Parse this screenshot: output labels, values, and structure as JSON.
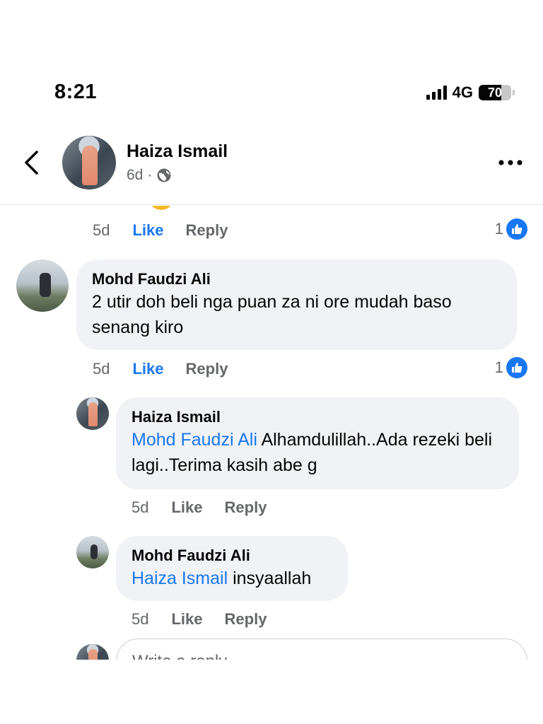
{
  "status_bar": {
    "time": "8:21",
    "network": "4G",
    "battery_level": "70",
    "battery_fraction": 0.7
  },
  "header": {
    "back_icon": "chevron-left-icon",
    "author_name": "Haiza Ismail",
    "post_age": "6d",
    "separator": "·",
    "audience_icon": "globe-icon",
    "more_icon": "more-horizontal-icon"
  },
  "comments": {
    "top_actions": {
      "time": "5d",
      "like": "Like",
      "reply": "Reply",
      "reaction_count": "1"
    },
    "items": [
      {
        "author": "Mohd Faudzi Ali",
        "text": "2 utir doh beli nga puan za ni ore mudah baso senang kiro",
        "time": "5d",
        "like": "Like",
        "reply": "Reply",
        "reaction_count": "1"
      }
    ],
    "replies": [
      {
        "author": "Haiza Ismail",
        "mention": "Mohd Faudzi Ali",
        "text": " Alhamdulillah..Ada rezeki beli lagi..Terima kasih abe g",
        "time": "5d",
        "like": "Like",
        "reply": "Reply"
      },
      {
        "author": "Mohd Faudzi Ali",
        "mention": "Haiza Ismail",
        "text": " insyaallah",
        "time": "5d",
        "like": "Like",
        "reply": "Reply"
      }
    ],
    "reply_input_placeholder": "Write a reply..."
  },
  "colors": {
    "accent": "#1877f2",
    "bubble": "#f0f2f5",
    "secondary_text": "#65676b"
  }
}
